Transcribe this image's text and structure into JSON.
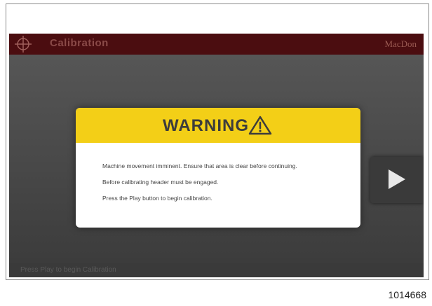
{
  "app": {
    "title": "Calibration",
    "brand": "MacDon"
  },
  "dialog": {
    "title": "WARNING",
    "lines": [
      "Machine movement imminent. Ensure that area is clear before continuing.",
      "Before calibrating header must be engaged.",
      "Press the Play button to begin calibration."
    ]
  },
  "status": {
    "text": "Press Play to begin Calibration"
  },
  "figure": {
    "reference_number": "1014668"
  },
  "colors": {
    "titlebar": "#4b0d10",
    "warning_header": "#f3cf17",
    "screen_background": "#444444"
  },
  "icons": {
    "app": "crosshair-icon",
    "warning": "warning-triangle-icon",
    "play": "play-icon"
  }
}
